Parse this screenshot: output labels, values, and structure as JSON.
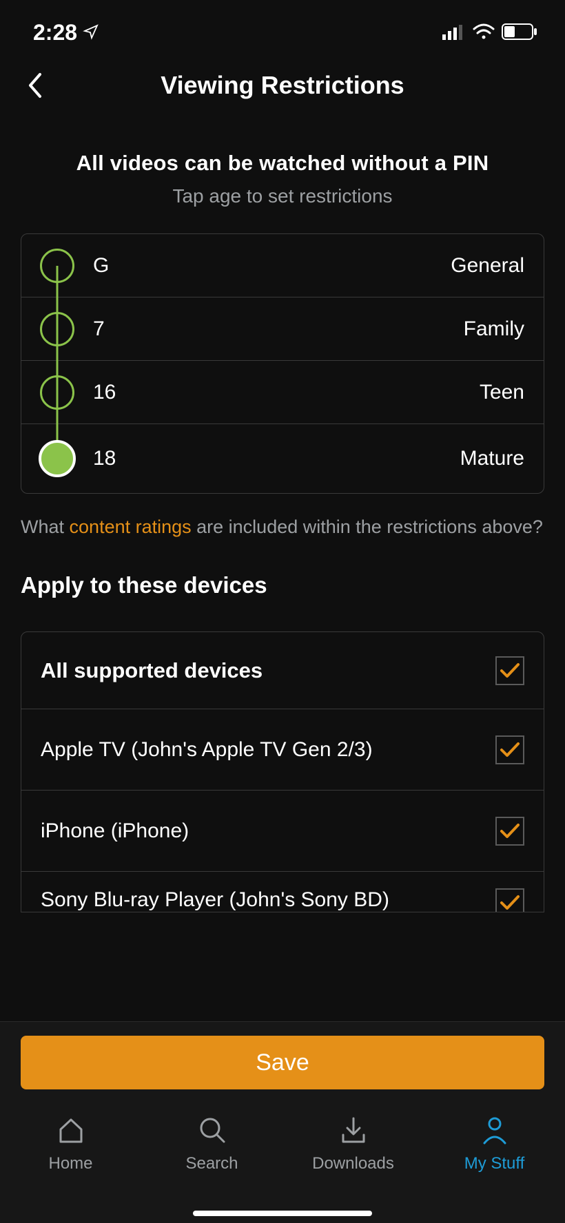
{
  "status": {
    "time": "2:28",
    "location_icon": "location-arrow",
    "signal_bars": 3,
    "wifi": true,
    "battery_pct": 35
  },
  "header": {
    "title": "Viewing Restrictions"
  },
  "restrictions": {
    "heading": "All videos can be watched without a PIN",
    "subheading": "Tap age to set restrictions",
    "levels": [
      {
        "code": "G",
        "label": "General"
      },
      {
        "code": "7",
        "label": "Family"
      },
      {
        "code": "16",
        "label": "Teen"
      },
      {
        "code": "18",
        "label": "Mature"
      }
    ],
    "selected_index": 3
  },
  "ratings_note": {
    "prefix": "What ",
    "link": "content ratings",
    "suffix": " are included within the restrictions above?"
  },
  "devices": {
    "heading": "Apply to these devices",
    "items": [
      {
        "label": "All supported devices",
        "checked": true,
        "bold": true
      },
      {
        "label": "Apple TV (John's Apple TV Gen 2/3)",
        "checked": true,
        "bold": false
      },
      {
        "label": "iPhone (iPhone)",
        "checked": true,
        "bold": false
      },
      {
        "label": "Sony Blu-ray Player (John's Sony BD)",
        "checked": true,
        "bold": false
      }
    ]
  },
  "save_button": "Save",
  "nav": {
    "items": [
      {
        "label": "Home"
      },
      {
        "label": "Search"
      },
      {
        "label": "Downloads"
      },
      {
        "label": "My Stuff"
      }
    ],
    "active_index": 3
  }
}
